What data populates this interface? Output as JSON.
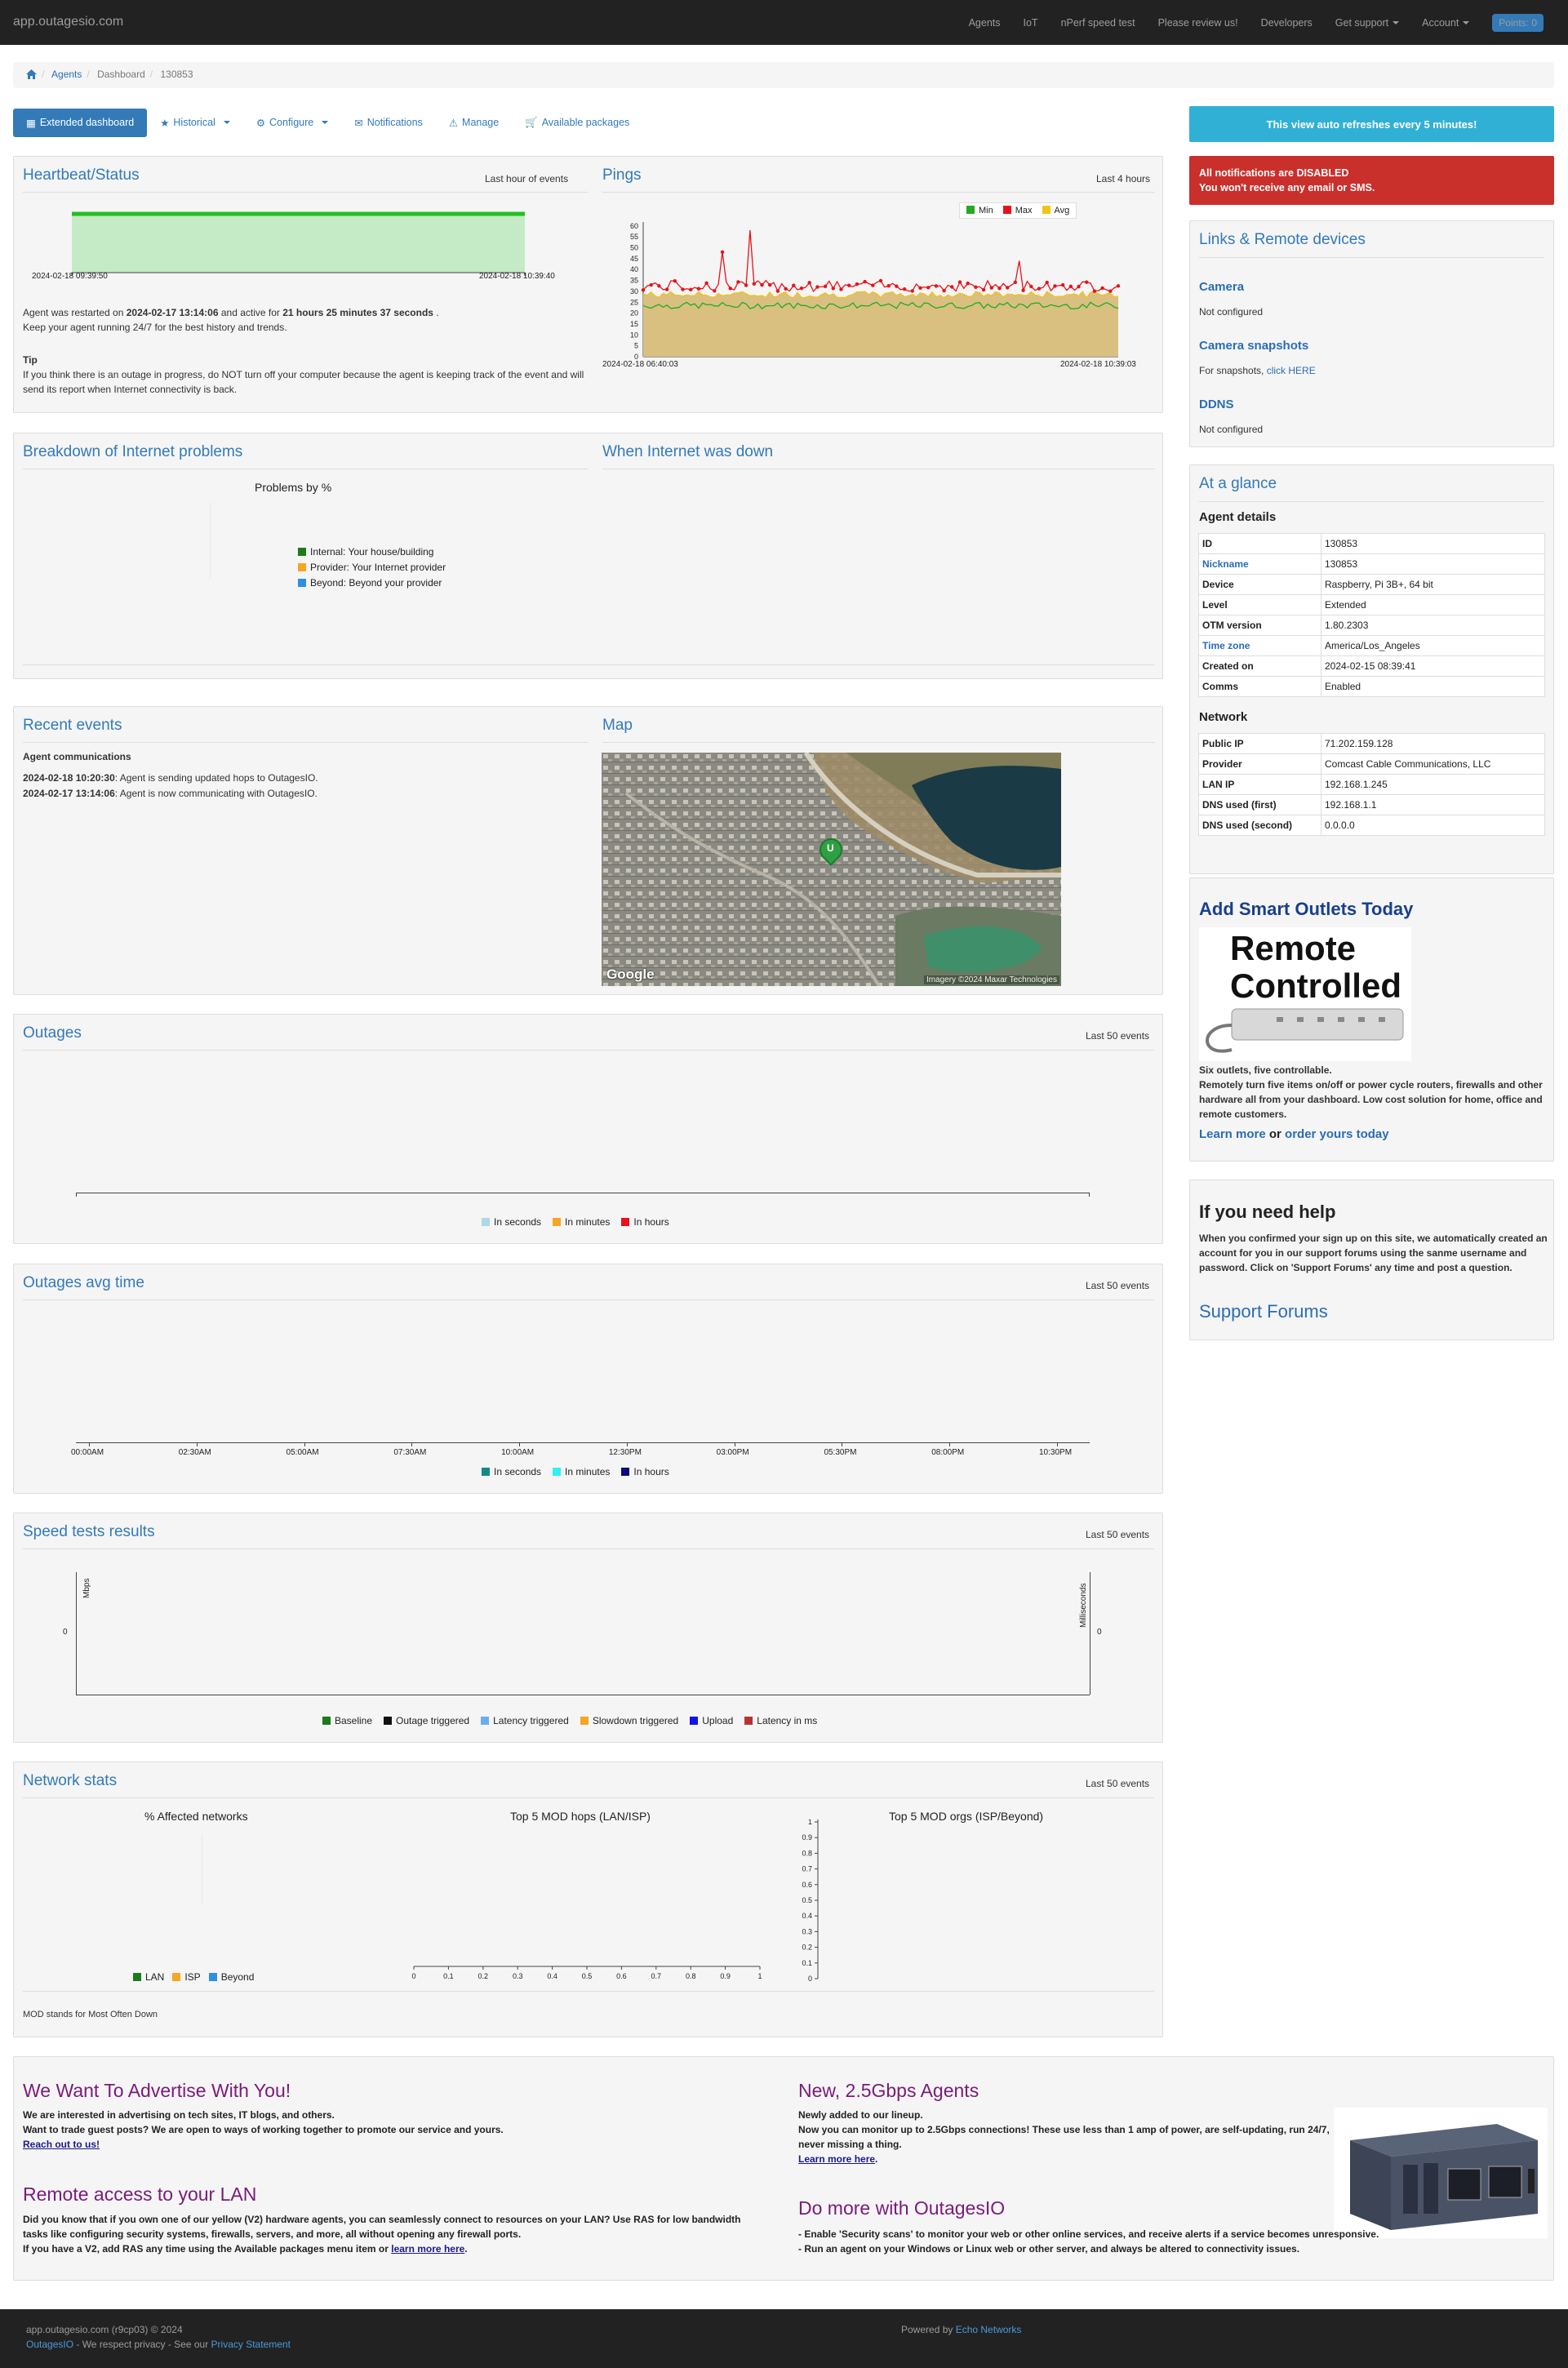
{
  "nav": {
    "brand": "app.outagesio.com",
    "links": [
      "Agents",
      "IoT",
      "nPerf speed test",
      "Please review us!",
      "Developers",
      "Get support",
      "Account"
    ],
    "points": "Points: 0"
  },
  "breadcrumb": {
    "items": [
      "Agents",
      "Dashboard",
      "130853"
    ]
  },
  "toolbar": {
    "items": [
      "Extended dashboard",
      "Historical",
      "Configure",
      "Notifications",
      "Manage",
      "Available packages"
    ]
  },
  "refresh_banner": "This view auto refreshes every 5 minutes!",
  "alert": {
    "line1": "All notifications are DISABLED",
    "line2": "You won't receive any email or SMS."
  },
  "heartbeat": {
    "title": "Heartbeat/Status",
    "range": "Last hour of events",
    "start": "2024-02-18 09:39:50",
    "end": "2024-02-18 10:39:40",
    "restart_prefix": "Agent was restarted on ",
    "restart_time": "2024-02-17 13:14:06",
    "restart_mid": " and active for ",
    "active_for": "21 hours 25 minutes 37 seconds",
    "restart_suffix": " .",
    "keep": "Keep your agent running 24/7 for the best history and trends.",
    "tip_title": "Tip",
    "tip": "If you think there is an outage in progress, do NOT turn off your computer because the agent is keeping track of the event and will send its report when Internet connectivity is back."
  },
  "pings": {
    "title": "Pings",
    "range": "Last 4 hours",
    "start": "2024-02-18 06:40:03",
    "end": "2024-02-18 10:39:03",
    "legend": [
      "Min",
      "Max",
      "Avg"
    ],
    "colors": {
      "min": "#22aa22",
      "max": "#e8121a",
      "avg": "#f2c318",
      "fill": "#d9c081"
    },
    "y_ticks": [
      "0",
      "5",
      "10",
      "15",
      "20",
      "25",
      "30",
      "35",
      "40",
      "45",
      "50",
      "55",
      "60"
    ]
  },
  "breakdown": {
    "title": "Breakdown of Internet problems",
    "chart_title": "Problems by %",
    "legend": [
      "Internal: Your house/building",
      "Provider: Your Internet provider",
      "Beyond: Beyond your provider"
    ],
    "colors": [
      "#1d7a1d",
      "#f5a623",
      "#2f8fe0"
    ]
  },
  "down": {
    "title": "When Internet was down"
  },
  "recent": {
    "title": "Recent events",
    "subtitle": "Agent communications",
    "events": [
      {
        "time": "2024-02-18 10:20:30",
        "text": ": Agent is sending updated hops to OutagesIO."
      },
      {
        "time": "2024-02-17 13:14:06",
        "text": ": Agent is now communicating with OutagesIO."
      }
    ]
  },
  "map": {
    "title": "Map",
    "marker": "U",
    "attribution": "Imagery ©2024 Maxar Technologies",
    "logo": "Google"
  },
  "outages": {
    "title": "Outages",
    "range": "Last 50 events",
    "legend": [
      "In seconds",
      "In minutes",
      "In hours"
    ],
    "colors": [
      "#add8e6",
      "#f5a623",
      "#e8121a"
    ]
  },
  "outages_avg": {
    "title": "Outages avg time",
    "range": "Last 50 events",
    "ticks": [
      "00:00AM",
      "02:30AM",
      "05:00AM",
      "07:30AM",
      "10:00AM",
      "12:30PM",
      "03:00PM",
      "05:30PM",
      "08:00PM",
      "10:30PM"
    ],
    "legend": [
      "In seconds",
      "In minutes",
      "In hours"
    ],
    "colors": [
      "#138a8a",
      "#2ef2f2",
      "#0b0b7a"
    ]
  },
  "speed": {
    "title": "Speed tests results",
    "range": "Last 50 events",
    "left_axis": "Mbps",
    "right_axis": "Milliseconds",
    "zero": "0",
    "legend": [
      "Baseline",
      "Outage triggered",
      "Latency triggered",
      "Slowdown triggered",
      "Upload",
      "Latency in ms"
    ],
    "colors": [
      "#1d7a1d",
      "#111111",
      "#6aaef0",
      "#f5a623",
      "#1212e8",
      "#b83232"
    ]
  },
  "netstats": {
    "title": "Network stats",
    "range": "Last 50 events",
    "affected": "% Affected networks",
    "hops": "Top 5 MOD hops (LAN/ISP)",
    "orgs": "Top 5 MOD orgs (ISP/Beyond)",
    "legend": [
      "LAN",
      "ISP",
      "Beyond"
    ],
    "colors": [
      "#1d7a1d",
      "#f5a623",
      "#2f8fe0"
    ],
    "ticks": [
      "0",
      "0.1",
      "0.2",
      "0.3",
      "0.4",
      "0.5",
      "0.6",
      "0.7",
      "0.8",
      "0.9",
      "1"
    ],
    "note": "MOD stands for Most Often Down"
  },
  "links": {
    "title": "Links & Remote devices",
    "camera": "Camera",
    "camera_status": "Not configured",
    "snap": "Camera snapshots",
    "snap_text": "For snapshots, ",
    "snap_link": "click HERE",
    "ddns": "DDNS",
    "ddns_status": "Not configured"
  },
  "glance": {
    "title": "At a glance",
    "agent_head": "Agent details",
    "agent": [
      [
        "ID",
        "130853"
      ],
      [
        "Nickname",
        "130853"
      ],
      [
        "Device",
        "Raspberry, Pi 3B+, 64 bit"
      ],
      [
        "Level",
        "Extended"
      ],
      [
        "OTM version",
        "1.80.2303"
      ],
      [
        "Time zone",
        "America/Los_Angeles"
      ],
      [
        "Created on",
        "2024-02-15 08:39:41"
      ],
      [
        "Comms",
        "Enabled"
      ]
    ],
    "network_head": "Network",
    "network": [
      [
        "Public IP",
        "71.202.159.128"
      ],
      [
        "Provider",
        "Comcast Cable Communications, LLC"
      ],
      [
        "LAN IP",
        "192.168.1.245"
      ],
      [
        "DNS used (first)",
        "192.168.1.1"
      ],
      [
        "DNS used (second)",
        "0.0.0.0"
      ]
    ]
  },
  "outlets": {
    "title": "Add Smart Outlets Today",
    "img_line1": "Remote",
    "img_line2": "Controlled",
    "line1": "Six outlets, five controllable.",
    "body": "Remotely turn five items on/off or power cycle routers, firewalls and other hardware all from your dashboard. Low cost solution for home, office and remote customers.",
    "learn": "Learn more",
    "or": " or ",
    "order": "order yours today"
  },
  "help": {
    "title": "If you need help",
    "body": "When you confirmed your sign up on this site, we automatically created an account for you in our support forums using the sanme username and password. Click on 'Support Forums' any time and post a question.",
    "link": "Support Forums"
  },
  "ads": {
    "a1_title": "We Want To Advertise With You!",
    "a1_l1": "We are interested in advertising on tech sites, IT blogs, and others.",
    "a1_l2": "Want to trade guest posts? We are open to ways of working together to promote our service and yours.",
    "a1_link": "Reach out to us!",
    "a2_title": "Remote access to your LAN",
    "a2_l1": "Did you know that if you own one of our yellow (V2) hardware agents, you can seamlessly connect to resources on your LAN? Use RAS for low bandwidth tasks like configuring security systems, firewalls, servers, and more, all without opening any firewall ports.",
    "a2_l2": "If you have a V2, add RAS any time using the Available packages menu item or ",
    "a2_link": "learn more here",
    "b1_title": "New, 2.5Gbps Agents",
    "b1_l1": "Newly added to our lineup.",
    "b1_l2": "Now you can monitor up to 2.5Gbps connections! These use less than 1 amp of power, are self-updating, run 24/7, never missing a thing.",
    "b1_link": "Learn more here",
    "b2_title": "Do more with OutagesIO",
    "b2_l1": "- Enable 'Security scans' to monitor your web or other online services, and receive alerts if a service becomes unresponsive.",
    "b2_l2": "- Run an agent on your Windows or Linux web or other server, and always be altered to connectivity issues."
  },
  "footer": {
    "line1": "app.outagesio.com (r9cp03) © 2024",
    "brand": "OutagesIO",
    "mid": " - We respect privacy - See our ",
    "privacy": "Privacy Statement",
    "powered": "Powered by ",
    "echo": "Echo Networks"
  }
}
